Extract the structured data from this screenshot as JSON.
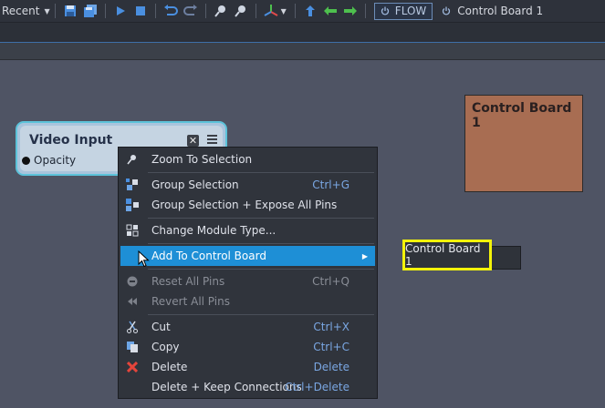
{
  "toolbar": {
    "recent_label": "Recent",
    "flow_label": "FLOW",
    "control_board_label": "Control Board 1",
    "icons": [
      "save-icon",
      "save-all-icon",
      "play-icon",
      "stop-icon",
      "undo-icon",
      "redo-icon",
      "zoom-in-icon",
      "zoom-out-icon",
      "axis-icon",
      "up-arrow-icon",
      "left-arrow-icon",
      "right-arrow-icon",
      "power-icon"
    ]
  },
  "canvas": {
    "node": {
      "title": "Video Input",
      "pin_label": "Opacity",
      "close_glyph": "✕"
    },
    "control_board": {
      "title": "Control Board 1",
      "color": "#a86d52"
    }
  },
  "context_menu": {
    "items": [
      {
        "label": "Zoom To Selection",
        "shortcut": "",
        "icon": "zoom-icon"
      },
      {
        "label": "Group Selection",
        "shortcut": "Ctrl+G",
        "icon": "group-icon"
      },
      {
        "label": "Group Selection + Expose All Pins",
        "shortcut": "",
        "icon": "group-expose-icon"
      },
      {
        "label": "Change Module Type...",
        "shortcut": "",
        "icon": "module-type-icon"
      },
      {
        "label": "Add To Control Board",
        "shortcut": "",
        "icon": "control-board-icon",
        "highlighted": true
      },
      {
        "label": "Reset All Pins",
        "shortcut": "Ctrl+Q",
        "icon": "reset-icon",
        "disabled": true
      },
      {
        "label": "Revert All Pins",
        "shortcut": "",
        "icon": "revert-icon",
        "disabled": true
      },
      {
        "label": "Cut",
        "shortcut": "Ctrl+X",
        "icon": "cut-icon"
      },
      {
        "label": "Copy",
        "shortcut": "Ctrl+C",
        "icon": "copy-icon"
      },
      {
        "label": "Delete",
        "shortcut": "Delete",
        "icon": "delete-icon"
      },
      {
        "label": "Delete + Keep Connections",
        "shortcut": "Ctrl+Delete",
        "icon": ""
      }
    ],
    "submenu_arrow": "▶"
  },
  "submenu": {
    "items": [
      {
        "label": "Control Board 1"
      }
    ]
  },
  "colors": {
    "highlight": "#1e8fd6",
    "shortcut": "#7aa7e3",
    "callout": "#f3f30a",
    "node_border": "#5cc3da"
  }
}
